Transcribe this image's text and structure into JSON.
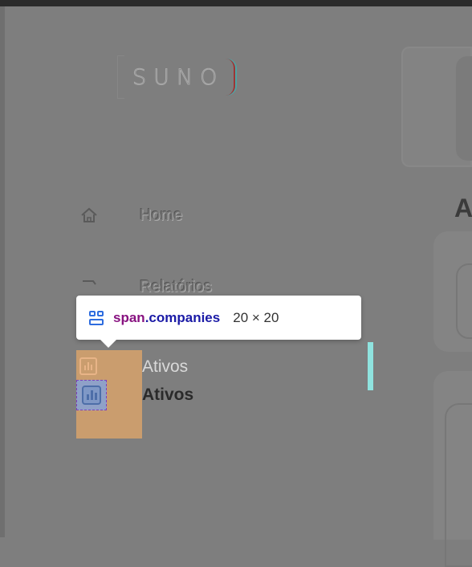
{
  "logo": {
    "text": "SUNO"
  },
  "sidebar": {
    "items": [
      {
        "label": "Home",
        "icon": "home-icon"
      },
      {
        "label": "Relatórios",
        "icon": "reports-icon"
      },
      {
        "label": "Ativos",
        "icon": "chart-icon",
        "active": true
      }
    ]
  },
  "main": {
    "title_fragment": "A"
  },
  "devtools_tooltip": {
    "element_tag": "span",
    "element_class": ".companies",
    "size": "20 × 20",
    "icon": "grid-layout-icon"
  },
  "colors": {
    "highlight": "#d0a06d",
    "active_indicator": "#8fe3df",
    "tooltip_tag": "#881280",
    "tooltip_class": "#1a1aa6",
    "tooltip_icon": "#2d6cdf"
  }
}
